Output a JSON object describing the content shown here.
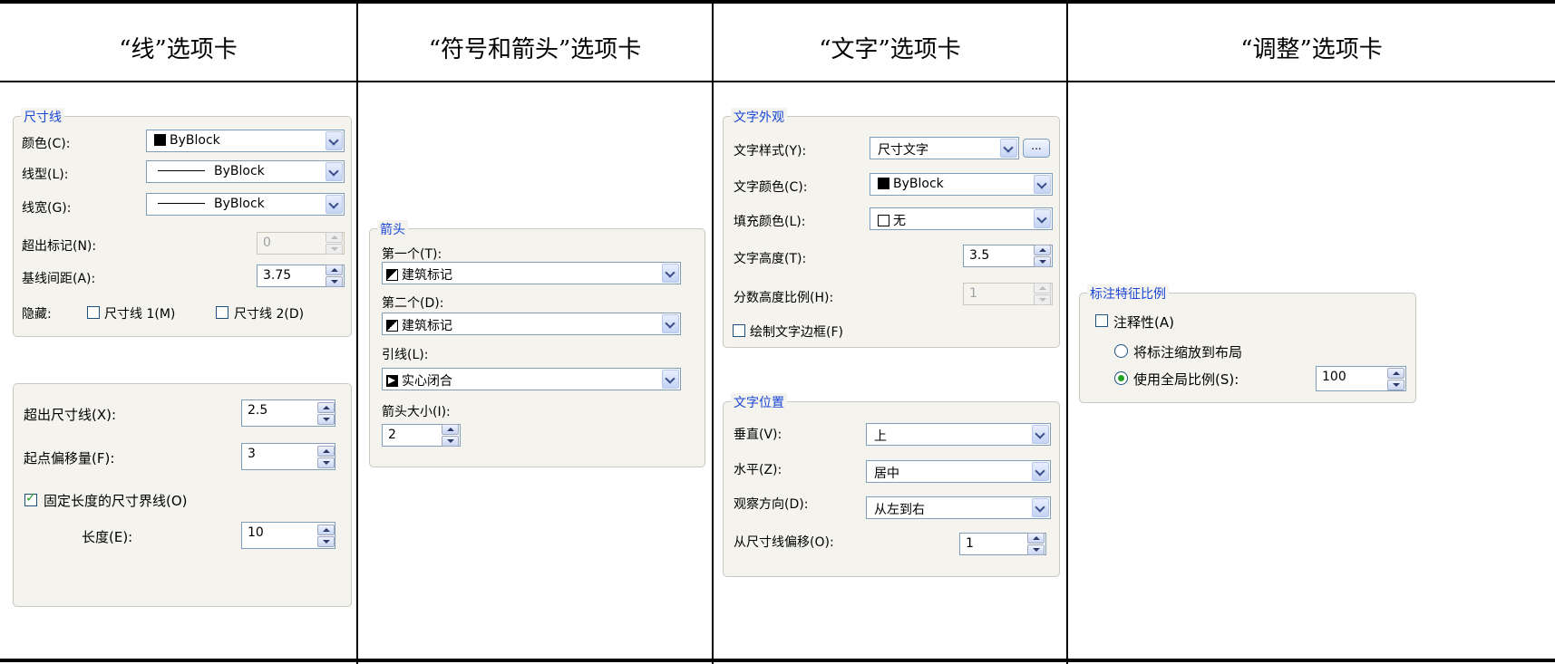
{
  "headers": [
    "“线”选项卡",
    "“符号和箭头”选项卡",
    "“文字”选项卡",
    "“调整”选项卡"
  ],
  "col1": {
    "group_title": "尺寸线",
    "color_label": "颜色(C):",
    "color_value": "ByBlock",
    "linetype_label": "线型(L):",
    "linetype_value": "ByBlock",
    "lineweight_label": "线宽(G):",
    "lineweight_value": "ByBlock",
    "extend_label": "超出标记(N):",
    "extend_value": "0",
    "baseline_label": "基线间距(A):",
    "baseline_value": "3.75",
    "hide_label": "隐藏:",
    "hide1_label": "尺寸线 1(M)",
    "hide2_label": "尺寸线 2(D)",
    "ext_beyond_label": "超出尺寸线(X):",
    "ext_beyond_value": "2.5",
    "offset_label": "起点偏移量(F):",
    "offset_value": "3",
    "fixed_label": "固定长度的尺寸界线(O)",
    "length_label": "长度(E):",
    "length_value": "10"
  },
  "col2": {
    "group_title": "箭头",
    "first_label": "第一个(T):",
    "first_value": "建筑标记",
    "second_label": "第二个(D):",
    "second_value": "建筑标记",
    "leader_label": "引线(L):",
    "leader_value": "实心闭合",
    "size_label": "箭头大小(I):",
    "size_value": "2"
  },
  "col3": {
    "appearance_title": "文字外观",
    "style_label": "文字样式(Y):",
    "style_value": "尺寸文字",
    "ellipsis": "...",
    "color_label": "文字颜色(C):",
    "color_value": "ByBlock",
    "fill_label": "填充颜色(L):",
    "fill_value": "无",
    "height_label": "文字高度(T):",
    "height_value": "3.5",
    "fraction_label": "分数高度比例(H):",
    "fraction_value": "1",
    "frame_label": "绘制文字边框(F)",
    "placement_title": "文字位置",
    "vertical_label": "垂直(V):",
    "vertical_value": "上",
    "horizontal_label": "水平(Z):",
    "horizontal_value": "居中",
    "view_label": "观察方向(D):",
    "view_value": "从左到右",
    "offset_label": "从尺寸线偏移(O):",
    "offset_value": "1"
  },
  "col4": {
    "group_title": "标注特征比例",
    "annotative_label": "注释性(A)",
    "scale_layout_label": "将标注缩放到布局",
    "global_label": "使用全局比例(S):",
    "global_value": "100"
  }
}
